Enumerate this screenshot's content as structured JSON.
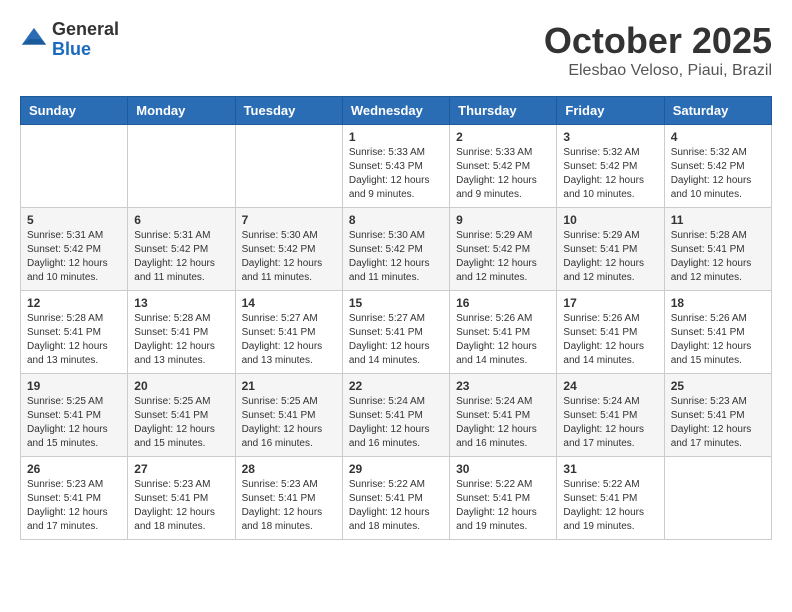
{
  "header": {
    "logo": {
      "line1": "General",
      "line2": "Blue"
    },
    "month": "October 2025",
    "location": "Elesbao Veloso, Piaui, Brazil"
  },
  "weekdays": [
    "Sunday",
    "Monday",
    "Tuesday",
    "Wednesday",
    "Thursday",
    "Friday",
    "Saturday"
  ],
  "weeks": [
    [
      null,
      null,
      null,
      {
        "day": "1",
        "sunrise": "5:33 AM",
        "sunset": "5:43 PM",
        "daylight": "12 hours and 9 minutes."
      },
      {
        "day": "2",
        "sunrise": "5:33 AM",
        "sunset": "5:42 PM",
        "daylight": "12 hours and 9 minutes."
      },
      {
        "day": "3",
        "sunrise": "5:32 AM",
        "sunset": "5:42 PM",
        "daylight": "12 hours and 10 minutes."
      },
      {
        "day": "4",
        "sunrise": "5:32 AM",
        "sunset": "5:42 PM",
        "daylight": "12 hours and 10 minutes."
      }
    ],
    [
      {
        "day": "5",
        "sunrise": "5:31 AM",
        "sunset": "5:42 PM",
        "daylight": "12 hours and 10 minutes."
      },
      {
        "day": "6",
        "sunrise": "5:31 AM",
        "sunset": "5:42 PM",
        "daylight": "12 hours and 11 minutes."
      },
      {
        "day": "7",
        "sunrise": "5:30 AM",
        "sunset": "5:42 PM",
        "daylight": "12 hours and 11 minutes."
      },
      {
        "day": "8",
        "sunrise": "5:30 AM",
        "sunset": "5:42 PM",
        "daylight": "12 hours and 11 minutes."
      },
      {
        "day": "9",
        "sunrise": "5:29 AM",
        "sunset": "5:42 PM",
        "daylight": "12 hours and 12 minutes."
      },
      {
        "day": "10",
        "sunrise": "5:29 AM",
        "sunset": "5:41 PM",
        "daylight": "12 hours and 12 minutes."
      },
      {
        "day": "11",
        "sunrise": "5:28 AM",
        "sunset": "5:41 PM",
        "daylight": "12 hours and 12 minutes."
      }
    ],
    [
      {
        "day": "12",
        "sunrise": "5:28 AM",
        "sunset": "5:41 PM",
        "daylight": "12 hours and 13 minutes."
      },
      {
        "day": "13",
        "sunrise": "5:28 AM",
        "sunset": "5:41 PM",
        "daylight": "12 hours and 13 minutes."
      },
      {
        "day": "14",
        "sunrise": "5:27 AM",
        "sunset": "5:41 PM",
        "daylight": "12 hours and 13 minutes."
      },
      {
        "day": "15",
        "sunrise": "5:27 AM",
        "sunset": "5:41 PM",
        "daylight": "12 hours and 14 minutes."
      },
      {
        "day": "16",
        "sunrise": "5:26 AM",
        "sunset": "5:41 PM",
        "daylight": "12 hours and 14 minutes."
      },
      {
        "day": "17",
        "sunrise": "5:26 AM",
        "sunset": "5:41 PM",
        "daylight": "12 hours and 14 minutes."
      },
      {
        "day": "18",
        "sunrise": "5:26 AM",
        "sunset": "5:41 PM",
        "daylight": "12 hours and 15 minutes."
      }
    ],
    [
      {
        "day": "19",
        "sunrise": "5:25 AM",
        "sunset": "5:41 PM",
        "daylight": "12 hours and 15 minutes."
      },
      {
        "day": "20",
        "sunrise": "5:25 AM",
        "sunset": "5:41 PM",
        "daylight": "12 hours and 15 minutes."
      },
      {
        "day": "21",
        "sunrise": "5:25 AM",
        "sunset": "5:41 PM",
        "daylight": "12 hours and 16 minutes."
      },
      {
        "day": "22",
        "sunrise": "5:24 AM",
        "sunset": "5:41 PM",
        "daylight": "12 hours and 16 minutes."
      },
      {
        "day": "23",
        "sunrise": "5:24 AM",
        "sunset": "5:41 PM",
        "daylight": "12 hours and 16 minutes."
      },
      {
        "day": "24",
        "sunrise": "5:24 AM",
        "sunset": "5:41 PM",
        "daylight": "12 hours and 17 minutes."
      },
      {
        "day": "25",
        "sunrise": "5:23 AM",
        "sunset": "5:41 PM",
        "daylight": "12 hours and 17 minutes."
      }
    ],
    [
      {
        "day": "26",
        "sunrise": "5:23 AM",
        "sunset": "5:41 PM",
        "daylight": "12 hours and 17 minutes."
      },
      {
        "day": "27",
        "sunrise": "5:23 AM",
        "sunset": "5:41 PM",
        "daylight": "12 hours and 18 minutes."
      },
      {
        "day": "28",
        "sunrise": "5:23 AM",
        "sunset": "5:41 PM",
        "daylight": "12 hours and 18 minutes."
      },
      {
        "day": "29",
        "sunrise": "5:22 AM",
        "sunset": "5:41 PM",
        "daylight": "12 hours and 18 minutes."
      },
      {
        "day": "30",
        "sunrise": "5:22 AM",
        "sunset": "5:41 PM",
        "daylight": "12 hours and 19 minutes."
      },
      {
        "day": "31",
        "sunrise": "5:22 AM",
        "sunset": "5:41 PM",
        "daylight": "12 hours and 19 minutes."
      },
      null
    ]
  ]
}
